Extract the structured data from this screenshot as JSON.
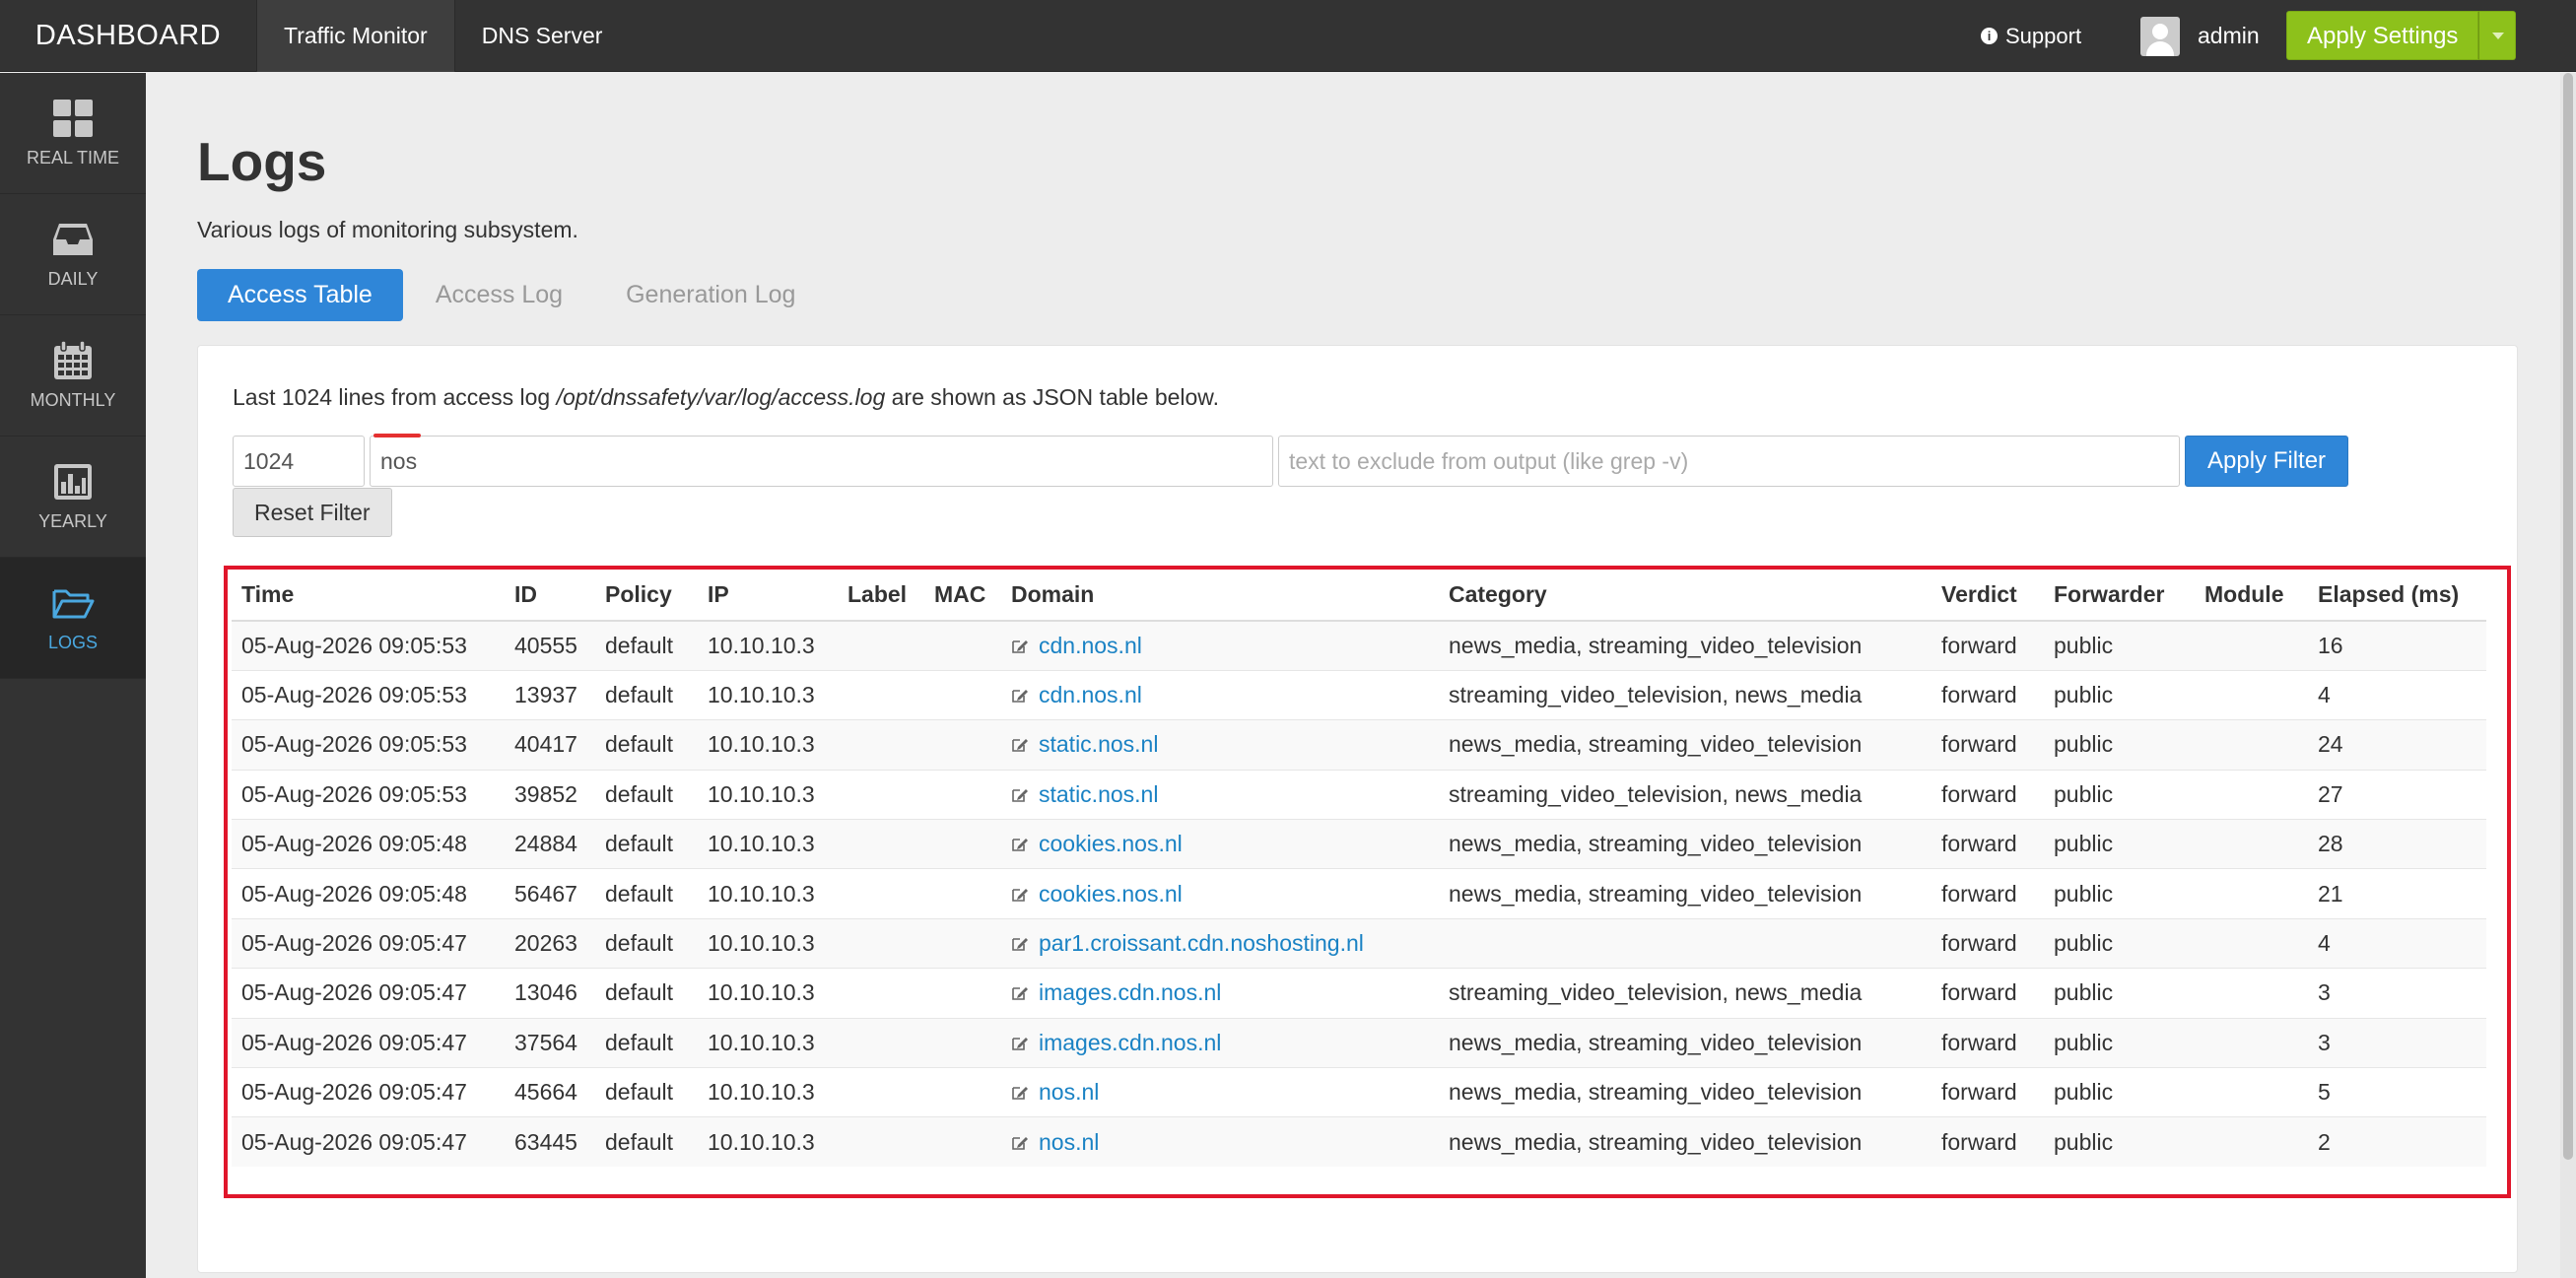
{
  "brand": "DASHBOARD",
  "topnav": [
    {
      "label": "Traffic Monitor",
      "active": true
    },
    {
      "label": "DNS Server",
      "active": false
    }
  ],
  "support": {
    "label": "Support",
    "icon": "info-icon"
  },
  "user": {
    "name": "admin",
    "icon": "user-avatar-icon"
  },
  "apply_settings": "Apply Settings",
  "sidebar": [
    {
      "label": "REAL TIME",
      "icon": "grid-icon"
    },
    {
      "label": "DAILY",
      "icon": "inbox-icon"
    },
    {
      "label": "MONTHLY",
      "icon": "calendar-icon"
    },
    {
      "label": "YEARLY",
      "icon": "bar-chart-icon"
    },
    {
      "label": "LOGS",
      "icon": "folder-open-icon",
      "active": true
    }
  ],
  "page": {
    "title": "Logs",
    "description": "Various logs of monitoring subsystem."
  },
  "tabs": [
    {
      "label": "Access Table",
      "active": true
    },
    {
      "label": "Access Log",
      "active": false
    },
    {
      "label": "Generation Log",
      "active": false
    }
  ],
  "panel": {
    "intro_before": "Last 1024 lines from access log ",
    "intro_path": "/opt/dnssafety/var/log/access.log",
    "intro_after": " are shown as JSON table below.",
    "lines_value": "1024",
    "include_value": "nos",
    "exclude_placeholder": "text to exclude from output (like grep -v)",
    "apply_filter": "Apply Filter",
    "reset_filter": "Reset Filter"
  },
  "table": {
    "columns": [
      "Time",
      "ID",
      "Policy",
      "IP",
      "Label",
      "MAC",
      "Domain",
      "Category",
      "Verdict",
      "Forwarder",
      "Module",
      "Elapsed (ms)"
    ],
    "rows": [
      {
        "time": "05-Aug-2026 09:05:53",
        "id": "40555",
        "policy": "default",
        "ip": "10.10.10.3",
        "label": "",
        "mac": "",
        "domain": "cdn.nos.nl",
        "category": "news_media, streaming_video_television",
        "verdict": "forward",
        "forwarder": "public",
        "module": "",
        "elapsed": "16"
      },
      {
        "time": "05-Aug-2026 09:05:53",
        "id": "13937",
        "policy": "default",
        "ip": "10.10.10.3",
        "label": "",
        "mac": "",
        "domain": "cdn.nos.nl",
        "category": "streaming_video_television, news_media",
        "verdict": "forward",
        "forwarder": "public",
        "module": "",
        "elapsed": "4"
      },
      {
        "time": "05-Aug-2026 09:05:53",
        "id": "40417",
        "policy": "default",
        "ip": "10.10.10.3",
        "label": "",
        "mac": "",
        "domain": "static.nos.nl",
        "category": "news_media, streaming_video_television",
        "verdict": "forward",
        "forwarder": "public",
        "module": "",
        "elapsed": "24"
      },
      {
        "time": "05-Aug-2026 09:05:53",
        "id": "39852",
        "policy": "default",
        "ip": "10.10.10.3",
        "label": "",
        "mac": "",
        "domain": "static.nos.nl",
        "category": "streaming_video_television, news_media",
        "verdict": "forward",
        "forwarder": "public",
        "module": "",
        "elapsed": "27"
      },
      {
        "time": "05-Aug-2026 09:05:48",
        "id": "24884",
        "policy": "default",
        "ip": "10.10.10.3",
        "label": "",
        "mac": "",
        "domain": "cookies.nos.nl",
        "category": "news_media, streaming_video_television",
        "verdict": "forward",
        "forwarder": "public",
        "module": "",
        "elapsed": "28"
      },
      {
        "time": "05-Aug-2026 09:05:48",
        "id": "56467",
        "policy": "default",
        "ip": "10.10.10.3",
        "label": "",
        "mac": "",
        "domain": "cookies.nos.nl",
        "category": "news_media, streaming_video_television",
        "verdict": "forward",
        "forwarder": "public",
        "module": "",
        "elapsed": "21"
      },
      {
        "time": "05-Aug-2026 09:05:47",
        "id": "20263",
        "policy": "default",
        "ip": "10.10.10.3",
        "label": "",
        "mac": "",
        "domain": "par1.croissant.cdn.noshosting.nl",
        "category": "",
        "verdict": "forward",
        "forwarder": "public",
        "module": "",
        "elapsed": "4"
      },
      {
        "time": "05-Aug-2026 09:05:47",
        "id": "13046",
        "policy": "default",
        "ip": "10.10.10.3",
        "label": "",
        "mac": "",
        "domain": "images.cdn.nos.nl",
        "category": "streaming_video_television, news_media",
        "verdict": "forward",
        "forwarder": "public",
        "module": "",
        "elapsed": "3"
      },
      {
        "time": "05-Aug-2026 09:05:47",
        "id": "37564",
        "policy": "default",
        "ip": "10.10.10.3",
        "label": "",
        "mac": "",
        "domain": "images.cdn.nos.nl",
        "category": "news_media, streaming_video_television",
        "verdict": "forward",
        "forwarder": "public",
        "module": "",
        "elapsed": "3"
      },
      {
        "time": "05-Aug-2026 09:05:47",
        "id": "45664",
        "policy": "default",
        "ip": "10.10.10.3",
        "label": "",
        "mac": "",
        "domain": "nos.nl",
        "category": "news_media, streaming_video_television",
        "verdict": "forward",
        "forwarder": "public",
        "module": "",
        "elapsed": "5"
      },
      {
        "time": "05-Aug-2026 09:05:47",
        "id": "63445",
        "policy": "default",
        "ip": "10.10.10.3",
        "label": "",
        "mac": "",
        "domain": "nos.nl",
        "category": "news_media, streaming_video_television",
        "verdict": "forward",
        "forwarder": "public",
        "module": "",
        "elapsed": "2"
      }
    ]
  },
  "colors": {
    "topbar": "#333333",
    "accent_blue": "#2f86d8",
    "apply_green": "#8dc11b",
    "link": "#1a82c4",
    "highlight_red": "#e0162b"
  }
}
